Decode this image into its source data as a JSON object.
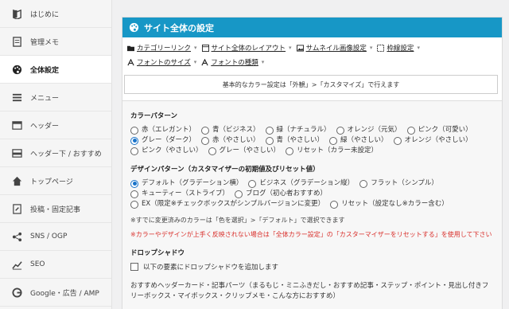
{
  "sidebar": {
    "items": [
      {
        "label": "はじめに",
        "icon": "book-icon"
      },
      {
        "label": "管理メモ",
        "icon": "memo-icon"
      },
      {
        "label": "全体設定",
        "icon": "palette-icon",
        "active": true
      },
      {
        "label": "メニュー",
        "icon": "menu-icon"
      },
      {
        "label": "ヘッダー",
        "icon": "header-icon"
      },
      {
        "label": "ヘッダー下 / おすすめ",
        "icon": "header-below-icon"
      },
      {
        "label": "トップページ",
        "icon": "home-icon"
      },
      {
        "label": "投稿・固定記事",
        "icon": "post-icon"
      },
      {
        "label": "SNS / OGP",
        "icon": "share-icon"
      },
      {
        "label": "SEO",
        "icon": "chart-icon"
      },
      {
        "label": "Google・広告 / AMP",
        "icon": "google-icon"
      }
    ]
  },
  "main": {
    "title": "サイト全体の設定",
    "title_icon": "palette-icon",
    "tabs": [
      {
        "label": "カテゴリーリンク",
        "icon": "folder-icon"
      },
      {
        "label": "サイト全体のレイアウト",
        "icon": "layout-icon"
      },
      {
        "label": "サムネイル画像設定",
        "icon": "image-icon"
      },
      {
        "label": "枠線設定",
        "icon": "border-icon"
      },
      {
        "label": "フォントのサイズ",
        "icon": "font-icon"
      },
      {
        "label": "フォントの種類",
        "icon": "font-icon"
      }
    ],
    "info": "基本的なカラー設定は「外観」>「カスタマイズ」で行えます",
    "color_pattern": {
      "title": "カラーパターン",
      "options": [
        "赤（エレガント）",
        "青（ビジネス）",
        "緑（ナチュラル）",
        "オレンジ（元気）",
        "ピンク（可愛い）",
        "グレー（ダーク）",
        "赤（やさしい）",
        "青（やさしい）",
        "緑（やさしい）",
        "オレンジ（やさしい）",
        "ピンク（やさしい）",
        "グレー（やさしい）",
        "リセット（カラー未設定）"
      ],
      "selected": 5
    },
    "design_pattern": {
      "title": "デザインパターン（カスタマイザーの初期値及びリセット値）",
      "options": [
        "デフォルト（グラデーション横）",
        "ビジネス（グラデーション縦）",
        "フラット（シンプル）",
        "キューティー（ストライプ）",
        "ブログ（初心者おすすめ）",
        "EX（限定※チェックボックスがシンプルバージョンに変更）",
        "リセット（設定なし※カラー含む）"
      ],
      "selected": 0
    },
    "note": "※すでに変更済みのカラーは「色を選択」>「デフォルト」で選択できます",
    "warning": "※カラーやデザインが上手く反映されない場合は「全体カラー設定」の「カスターマイザーをリセットする」を使用して下さい",
    "drop_shadow": {
      "title": "ドロップシャドウ",
      "checkbox_label": "以下の要素にドロップシャドウを追加します",
      "description": "おすすめヘッダーカード・記事パーツ（まるもじ・ミニふきだし・おすすめ記事・ステップ・ポイント・見出し付きフリーボックス・マイボックス・クリップメモ・こんな方におすすめ）"
    }
  },
  "colors": {
    "title_bar": "#1797c6",
    "warning": "#d9312d",
    "radio_checked": "#1a73c9"
  }
}
